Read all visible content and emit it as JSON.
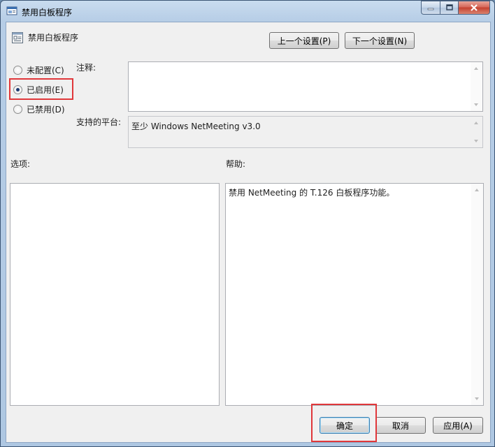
{
  "window": {
    "title": "禁用白板程序",
    "title_buttons": [
      "minimize",
      "maximize",
      "close"
    ]
  },
  "header": {
    "setting_name": "禁用白板程序",
    "prev_button": "上一个设置(P)",
    "next_button": "下一个设置(N)"
  },
  "state": {
    "options": [
      {
        "label": "未配置(C)",
        "checked": false
      },
      {
        "label": "已启用(E)",
        "checked": true
      },
      {
        "label": "已禁用(D)",
        "checked": false
      }
    ]
  },
  "comment": {
    "label": "注释:",
    "value": ""
  },
  "platform": {
    "label": "支持的平台:",
    "value": "至少 Windows NetMeeting v3.0"
  },
  "options_section": {
    "label": "选项:"
  },
  "help_section": {
    "label": "帮助:",
    "text": "禁用 NetMeeting 的 T.126 白板程序功能。"
  },
  "footer": {
    "ok": "确定",
    "cancel": "取消",
    "apply": "应用(A)"
  },
  "colors": {
    "highlight": "#e0373a",
    "title_gradient": "#b6cde6",
    "client_bg": "#f0f0f0"
  }
}
